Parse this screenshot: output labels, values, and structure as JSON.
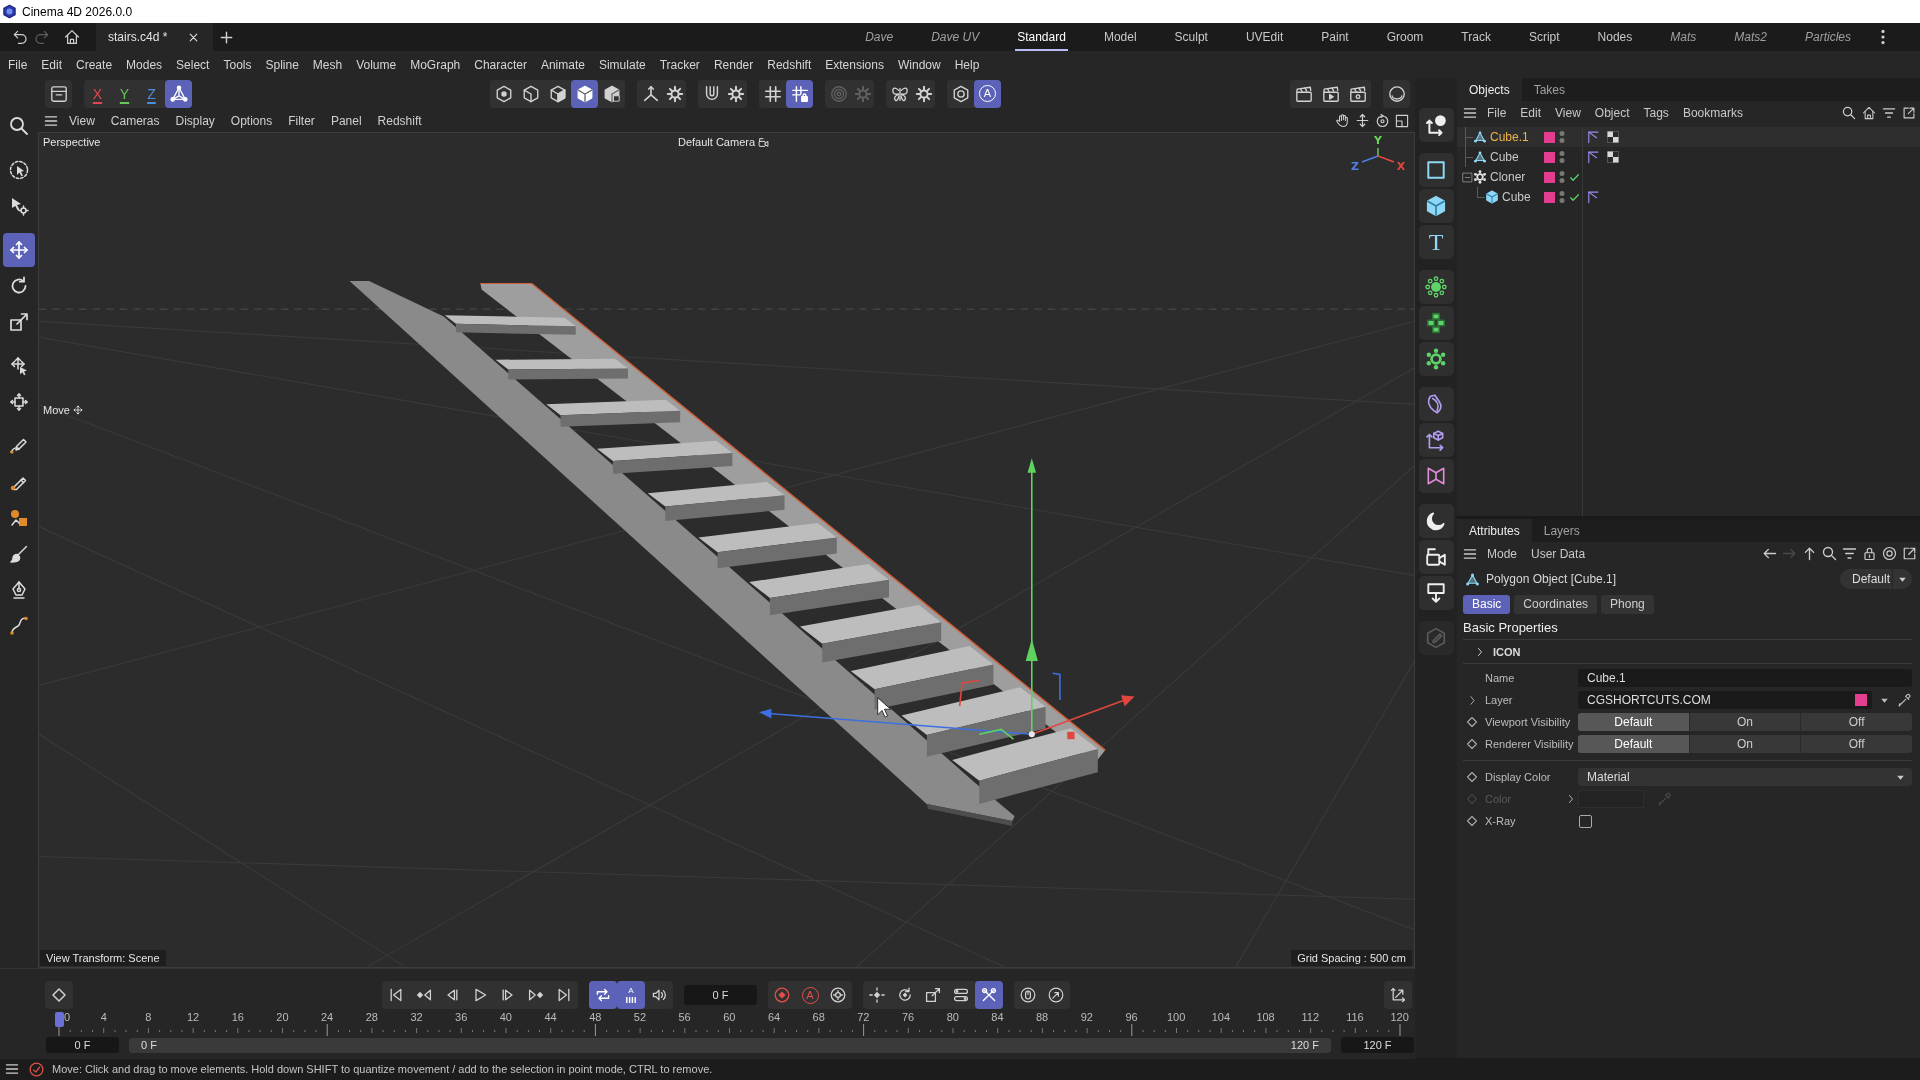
{
  "window": {
    "title": "Cinema 4D 2026.0.0"
  },
  "tab_bar": {
    "history": [
      {
        "kind": "undo",
        "disabled": false
      },
      {
        "kind": "redo",
        "disabled": true
      }
    ],
    "documents": [
      {
        "label": "stairs.c4d *",
        "selected": true
      }
    ],
    "layouts": [
      {
        "label": "Dave",
        "selected": false,
        "italic": true
      },
      {
        "label": "Dave UV",
        "selected": false,
        "italic": true
      },
      {
        "label": "Standard",
        "selected": true,
        "italic": false
      },
      {
        "label": "Model",
        "selected": false,
        "italic": false
      },
      {
        "label": "Sculpt",
        "selected": false,
        "italic": false
      },
      {
        "label": "UVEdit",
        "selected": false,
        "italic": false
      },
      {
        "label": "Paint",
        "selected": false,
        "italic": false
      },
      {
        "label": "Groom",
        "selected": false,
        "italic": false
      },
      {
        "label": "Track",
        "selected": false,
        "italic": false
      },
      {
        "label": "Script",
        "selected": false,
        "italic": false
      },
      {
        "label": "Nodes",
        "selected": false,
        "italic": false
      },
      {
        "label": "Mats",
        "selected": false,
        "italic": true
      },
      {
        "label": "Mats2",
        "selected": false,
        "italic": true
      },
      {
        "label": "Particles",
        "selected": false,
        "italic": true
      }
    ]
  },
  "menu_bar": [
    "File",
    "Edit",
    "Create",
    "Modes",
    "Select",
    "Tools",
    "Spline",
    "Mesh",
    "Volume",
    "MoGraph",
    "Character",
    "Animate",
    "Simulate",
    "Tracker",
    "Render",
    "Redshift",
    "Extensions",
    "Window",
    "Help"
  ],
  "toolbar": {
    "left": [
      [
        {
          "kind": "panel",
          "selected": false,
          "disabled": false
        }
      ],
      [
        {
          "kind": "axis-lock",
          "label": "X",
          "color": "#e2474d",
          "selected": false,
          "disabled": false
        },
        {
          "kind": "axis-lock",
          "label": "Y",
          "color": "#67c75a",
          "selected": false,
          "disabled": false
        },
        {
          "kind": "axis-lock",
          "label": "Z",
          "color": "#4a90e2",
          "selected": false,
          "disabled": false
        },
        {
          "kind": "coordinate-system",
          "selected": true,
          "disabled": false
        }
      ]
    ],
    "center": [
      [
        {
          "kind": "points",
          "selected": false,
          "disabled": false
        },
        {
          "kind": "edges",
          "selected": false,
          "disabled": false
        },
        {
          "kind": "polygons",
          "selected": false,
          "disabled": false
        },
        {
          "kind": "model",
          "selected": true,
          "disabled": false
        },
        {
          "kind": "uv",
          "selected": false,
          "disabled": false
        }
      ],
      [
        {
          "kind": "axis",
          "selected": false,
          "disabled": false
        },
        {
          "kind": "settings",
          "selected": false,
          "disabled": false
        }
      ],
      [
        {
          "kind": "snap",
          "selected": false,
          "disabled": false
        },
        {
          "kind": "settings",
          "selected": false,
          "disabled": false
        }
      ],
      [
        {
          "kind": "grid",
          "selected": false,
          "disabled": false
        },
        {
          "kind": "grid-lock",
          "selected": true,
          "disabled": false
        }
      ],
      [
        {
          "kind": "soft-selection",
          "selected": false,
          "disabled": true
        },
        {
          "kind": "settings",
          "selected": false,
          "disabled": true
        }
      ],
      [
        {
          "kind": "symmetry",
          "selected": false,
          "disabled": false
        },
        {
          "kind": "settings",
          "selected": false,
          "disabled": false
        }
      ],
      [
        {
          "kind": "workplane",
          "selected": false,
          "disabled": false
        },
        {
          "kind": "auto-switch",
          "label": "A",
          "selected": true,
          "disabled": false
        }
      ]
    ],
    "right": [
      [
        {
          "kind": "render-view",
          "selected": false,
          "disabled": false
        },
        {
          "kind": "render",
          "selected": false,
          "disabled": false
        },
        {
          "kind": "render-settings",
          "selected": false,
          "disabled": false
        }
      ],
      [
        {
          "kind": "viewport-render",
          "selected": false,
          "disabled": false
        }
      ]
    ]
  },
  "left_tools": [
    [
      {
        "kind": "search",
        "selected": false
      }
    ],
    [
      {
        "kind": "live-selection",
        "selected": false
      },
      {
        "kind": "selection-settings",
        "selected": false
      }
    ],
    [
      {
        "kind": "move",
        "selected": true
      },
      {
        "kind": "rotate",
        "selected": false
      },
      {
        "kind": "scale",
        "selected": false
      }
    ],
    [
      {
        "kind": "placement",
        "selected": false
      },
      {
        "kind": "transform",
        "selected": false
      }
    ],
    [
      {
        "kind": "sketch",
        "selected": false
      },
      {
        "kind": "spline-pen",
        "selected": false
      },
      {
        "kind": "paint",
        "selected": false
      },
      {
        "kind": "brush",
        "selected": false
      },
      {
        "kind": "pen",
        "selected": false
      },
      {
        "kind": "spline-smooth",
        "selected": false
      }
    ]
  ],
  "viewport": {
    "menu": [
      "View",
      "Cameras",
      "Display",
      "Options",
      "Filter",
      "Panel",
      "Redshift"
    ],
    "camera_label": "Perspective",
    "camera_name": "Default Camera",
    "tool_label": "Move",
    "axes": [
      {
        "label": "Y",
        "color": "#6bd35c"
      },
      {
        "label": "Z",
        "color": "#4f7fe8"
      },
      {
        "label": "X",
        "color": "#e2473f"
      }
    ],
    "view_transform": "View Transform: Scene",
    "grid_spacing": "Grid Spacing : 500 cm"
  },
  "right_tools": [
    [
      {
        "kind": "null",
        "disabled": false
      }
    ],
    [
      {
        "kind": "spline",
        "disabled": false
      },
      {
        "kind": "cube",
        "disabled": false
      },
      {
        "kind": "text",
        "label": "T",
        "disabled": false
      }
    ],
    [
      {
        "kind": "array",
        "disabled": false
      },
      {
        "kind": "blocks",
        "disabled": false
      },
      {
        "kind": "cloner",
        "disabled": false
      }
    ],
    [
      {
        "kind": "deformer",
        "disabled": false
      },
      {
        "kind": "field",
        "disabled": false
      },
      {
        "kind": "volume",
        "disabled": false
      }
    ],
    [
      {
        "kind": "sky",
        "disabled": false
      },
      {
        "kind": "camera",
        "disabled": false
      },
      {
        "kind": "floor",
        "disabled": false
      }
    ],
    [
      {
        "kind": "edit",
        "disabled": true
      }
    ]
  ],
  "objects_panel": {
    "tabs": [
      {
        "label": "Objects",
        "selected": true
      },
      {
        "label": "Takes",
        "selected": false
      }
    ],
    "menu": [
      "File",
      "Edit",
      "View",
      "Object",
      "Tags",
      "Bookmarks"
    ],
    "tree": [
      {
        "name": "Cube.1",
        "kind": "polygon",
        "selected": true,
        "color": "#e23d8f",
        "checked": false,
        "tags": [
          {
            "kind": "phong"
          },
          {
            "kind": "material"
          }
        ]
      },
      {
        "name": "Cube",
        "kind": "polygon",
        "selected": false,
        "color": "#e23d8f",
        "checked": false,
        "tags": [
          {
            "kind": "phong"
          },
          {
            "kind": "material"
          }
        ]
      },
      {
        "name": "Cloner",
        "kind": "cloner",
        "selected": false,
        "color": "#e23d8f",
        "checked": true,
        "expanded": true,
        "children": [
          {
            "name": "Cube",
            "kind": "cube",
            "selected": false,
            "color": "#e23d8f",
            "checked": true,
            "tags": [
              {
                "kind": "phong"
              }
            ]
          }
        ]
      }
    ]
  },
  "attributes_panel": {
    "tabs": [
      {
        "label": "Attributes",
        "selected": true
      },
      {
        "label": "Layers",
        "selected": false
      }
    ],
    "menu": [
      "Mode",
      "User Data"
    ],
    "nav": [
      {
        "kind": "back",
        "disabled": false
      },
      {
        "kind": "forward",
        "disabled": true
      },
      {
        "kind": "up",
        "disabled": false
      },
      {
        "kind": "search",
        "disabled": false
      },
      {
        "kind": "filter",
        "disabled": false
      },
      {
        "kind": "lock",
        "disabled": false
      },
      {
        "kind": "target",
        "disabled": false
      },
      {
        "kind": "new-window",
        "disabled": false
      }
    ],
    "object_title": "Polygon Object [Cube.1]",
    "preset": "Default",
    "sub_tabs": [
      {
        "label": "Basic",
        "selected": true
      },
      {
        "label": "Coordinates",
        "selected": false
      },
      {
        "label": "Phong",
        "selected": false
      }
    ],
    "section": "Basic Properties",
    "groups": [
      {
        "label": "ICON",
        "expanded": false
      }
    ],
    "fields": [
      {
        "kind": "text",
        "label": "Name",
        "value": "Cube.1",
        "animatable": false,
        "disabled": false
      },
      {
        "kind": "layer",
        "label": "Layer",
        "value": "CGSHORTCUTS.COM",
        "color": "#e23d8f",
        "animatable": false,
        "disabled": false
      },
      {
        "kind": "segmented",
        "label": "Viewport Visibility",
        "animatable": true,
        "disabled": false,
        "options": [
          {
            "label": "Default",
            "selected": true
          },
          {
            "label": "On",
            "selected": false
          },
          {
            "label": "Off",
            "selected": false
          }
        ]
      },
      {
        "kind": "segmented",
        "label": "Renderer Visibility",
        "animatable": true,
        "disabled": false,
        "options": [
          {
            "label": "Default",
            "selected": true
          },
          {
            "label": "On",
            "selected": false
          },
          {
            "label": "Off",
            "selected": false
          }
        ]
      },
      {
        "kind": "dropdown",
        "label": "Display Color",
        "value": "Material",
        "animatable": true,
        "disabled": false
      },
      {
        "kind": "color",
        "label": "Color",
        "animatable": true,
        "disabled": true
      },
      {
        "kind": "checkbox",
        "label": "X-Ray",
        "checked": false,
        "animatable": true,
        "disabled": false
      }
    ]
  },
  "timeline": {
    "left": [
      [
        {
          "kind": "keyframe",
          "selected": false
        }
      ]
    ],
    "center": [
      {
        "kind": "group",
        "buttons": [
          {
            "kind": "first-frame",
            "selected": false
          },
          {
            "kind": "previous-key",
            "selected": false
          },
          {
            "kind": "previous-frame",
            "selected": false
          },
          {
            "kind": "play",
            "selected": false
          },
          {
            "kind": "next-frame",
            "selected": false
          },
          {
            "kind": "next-key",
            "selected": false
          },
          {
            "kind": "last-frame",
            "selected": false
          }
        ]
      },
      {
        "kind": "group",
        "buttons": [
          {
            "kind": "loop",
            "selected": true
          },
          {
            "kind": "interpolation",
            "label": "A",
            "selected": true
          },
          {
            "kind": "sound",
            "selected": false
          }
        ]
      },
      {
        "kind": "field",
        "value": "0 F"
      },
      {
        "kind": "group",
        "buttons": [
          {
            "kind": "record",
            "selected": false
          },
          {
            "kind": "autokey",
            "label": "A",
            "selected": false
          },
          {
            "kind": "key-settings",
            "selected": false
          }
        ]
      },
      {
        "kind": "group",
        "buttons": [
          {
            "kind": "key-position",
            "selected": false
          },
          {
            "kind": "key-rotation",
            "selected": false
          },
          {
            "kind": "key-scale",
            "selected": false
          },
          {
            "kind": "key-parameter",
            "selected": false
          },
          {
            "kind": "key-pla",
            "selected": true
          }
        ]
      },
      {
        "kind": "group",
        "buttons": [
          {
            "kind": "mouse",
            "selected": false
          },
          {
            "kind": "motion",
            "selected": false
          }
        ]
      }
    ],
    "right": [
      [
        {
          "kind": "fcurve",
          "selected": false
        }
      ]
    ],
    "ruler": [
      "0",
      "4",
      "8",
      "12",
      "16",
      "20",
      "24",
      "28",
      "32",
      "36",
      "40",
      "44",
      "48",
      "52",
      "56",
      "60",
      "64",
      "68",
      "72",
      "76",
      "80",
      "84",
      "88",
      "92",
      "96",
      "100",
      "104",
      "108",
      "112",
      "116",
      "120"
    ],
    "playhead": {
      "level": 0
    },
    "range": {
      "start": "0 F",
      "level": 1,
      "preview_start": "0 F",
      "preview_end": "120 F",
      "end": "120 F"
    }
  },
  "status_bar": {
    "message": "Move: Click and drag to move elements. Hold down SHIFT to quantize movement / add to the selection in point mode, CTRL to remove."
  }
}
